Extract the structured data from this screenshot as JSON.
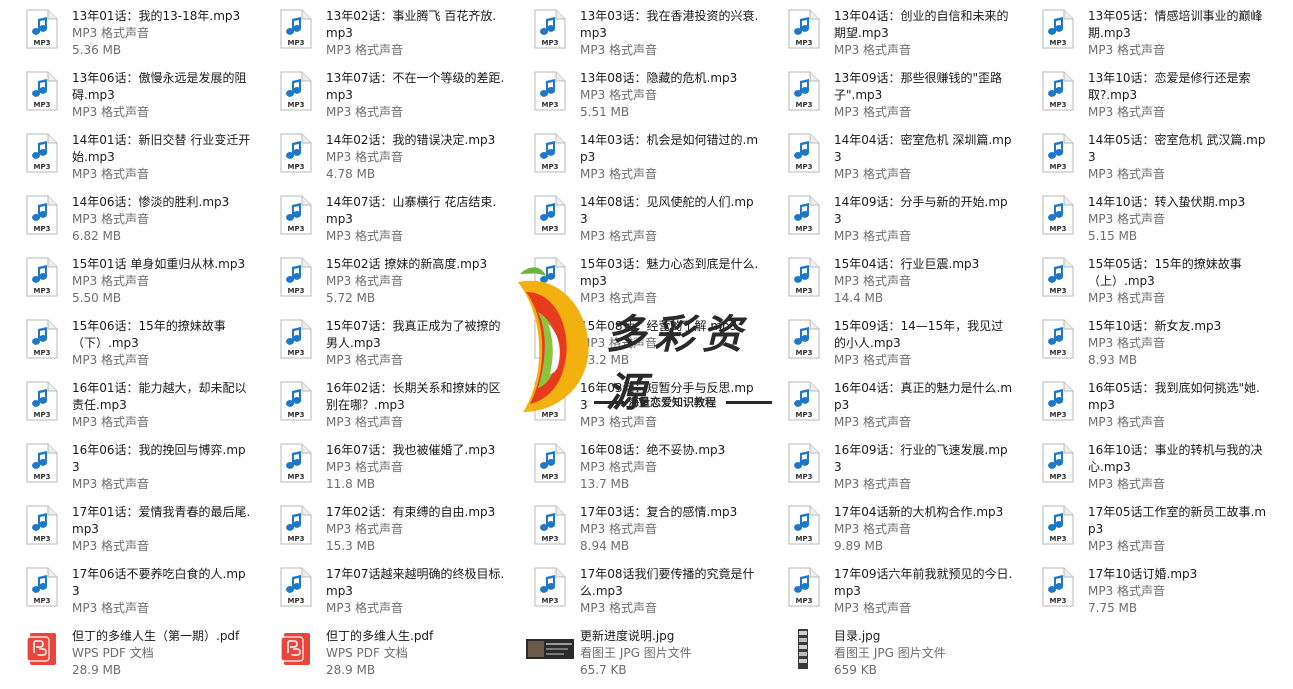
{
  "files": [
    {
      "name": "13年01话：我的13-18年.mp3",
      "type": "MP3 格式声音",
      "size": "5.36 MB",
      "icon": "mp3-file-icon"
    },
    {
      "name": "13年02话：事业腾飞 百花齐放.mp3",
      "type": "MP3 格式声音",
      "size": "",
      "icon": "mp3-file-icon"
    },
    {
      "name": "13年03话：我在香港投资的兴衰.mp3",
      "type": "MP3 格式声音",
      "size": "",
      "icon": "mp3-file-icon"
    },
    {
      "name": "13年04话：创业的自信和未来的期望.mp3",
      "type": "MP3 格式声音",
      "size": "",
      "icon": "mp3-file-icon"
    },
    {
      "name": "13年05话：情感培训事业的巅峰期.mp3",
      "type": "MP3 格式声音",
      "size": "",
      "icon": "mp3-file-icon"
    },
    {
      "name": "13年06话：傲慢永远是发展的阻碍.mp3",
      "type": "MP3 格式声音",
      "size": "",
      "icon": "mp3-file-icon"
    },
    {
      "name": "13年07话：不在一个等级的差距.mp3",
      "type": "MP3 格式声音",
      "size": "",
      "icon": "mp3-file-icon"
    },
    {
      "name": "13年08话：隐藏的危机.mp3",
      "type": "MP3 格式声音",
      "size": "5.51 MB",
      "icon": "mp3-file-icon"
    },
    {
      "name": "13年09话：那些很赚钱的\"歪路子\".mp3",
      "type": "MP3 格式声音",
      "size": "",
      "icon": "mp3-file-icon"
    },
    {
      "name": "13年10话：恋爱是修行还是索取?.mp3",
      "type": "MP3 格式声音",
      "size": "",
      "icon": "mp3-file-icon"
    },
    {
      "name": "14年01话：新旧交替 行业变迁开始.mp3",
      "type": "MP3 格式声音",
      "size": "",
      "icon": "mp3-file-icon"
    },
    {
      "name": "14年02话：我的错误决定.mp3",
      "type": "MP3 格式声音",
      "size": "4.78 MB",
      "icon": "mp3-file-icon"
    },
    {
      "name": "14年03话：机会是如何错过的.mp3",
      "type": "MP3 格式声音",
      "size": "",
      "icon": "mp3-file-icon"
    },
    {
      "name": "14年04话：密室危机 深圳篇.mp3",
      "type": "MP3 格式声音",
      "size": "8.16 MB",
      "icon": "mp3-file-icon"
    },
    {
      "name": "14年05话：密室危机 武汉篇.mp3",
      "type": "MP3 格式声音",
      "size": "4.85 MB",
      "icon": "mp3-file-icon"
    },
    {
      "name": "14年06话：惨淡的胜利.mp3",
      "type": "MP3 格式声音",
      "size": "6.82 MB",
      "icon": "mp3-file-icon"
    },
    {
      "name": "14年07话：山寨横行 花店结束.mp3",
      "type": "MP3 格式声音",
      "size": "",
      "icon": "mp3-file-icon"
    },
    {
      "name": "14年08话：见风使舵的人们.mp3",
      "type": "MP3 格式声音",
      "size": "5.29 MB",
      "icon": "mp3-file-icon"
    },
    {
      "name": "14年09话：分手与新的开始.mp3",
      "type": "MP3 格式声音",
      "size": "4.84 MB",
      "icon": "mp3-file-icon"
    },
    {
      "name": "14年10话：转入蛰伏期.mp3",
      "type": "MP3 格式声音",
      "size": "5.15 MB",
      "icon": "mp3-file-icon"
    },
    {
      "name": "15年01话 单身如重归从林.mp3",
      "type": "MP3 格式声音",
      "size": "5.50 MB",
      "icon": "mp3-file-icon"
    },
    {
      "name": "15年02话 撩妹的新高度.mp3",
      "type": "MP3 格式声音",
      "size": "5.72 MB",
      "icon": "mp3-file-icon"
    },
    {
      "name": "15年03话：魅力心态到底是什么.mp3",
      "type": "MP3 格式声音",
      "size": "",
      "icon": "mp3-file-icon"
    },
    {
      "name": "15年04话：行业巨震.mp3",
      "type": "MP3 格式声音",
      "size": "14.4 MB",
      "icon": "mp3-file-icon"
    },
    {
      "name": "15年05话：15年的撩妹故事（上）.mp3",
      "type": "MP3 格式声音",
      "size": "",
      "icon": "mp3-file-icon"
    },
    {
      "name": "15年06话：15年的撩妹故事（下）.mp3",
      "type": "MP3 格式声音",
      "size": "",
      "icon": "mp3-file-icon"
    },
    {
      "name": "15年07话：我真正成为了被撩的男人.mp3",
      "type": "MP3 格式声音",
      "size": "",
      "icon": "mp3-file-icon"
    },
    {
      "name": "15年08话：经营的了解.mp3",
      "type": "MP3 格式声音",
      "size": "13.2 MB",
      "icon": "mp3-file-icon"
    },
    {
      "name": "15年09话：14—15年，我见过的小人.mp3",
      "type": "MP3 格式声音",
      "size": "",
      "icon": "mp3-file-icon"
    },
    {
      "name": "15年10话：新女友.mp3",
      "type": "MP3 格式声音",
      "size": "8.93 MB",
      "icon": "mp3-file-icon"
    },
    {
      "name": "16年01话：能力越大，却未配以责任.mp3",
      "type": "MP3 格式声音",
      "size": "",
      "icon": "mp3-file-icon"
    },
    {
      "name": "16年02话：长期关系和撩妹的区别在哪？.mp3",
      "type": "MP3 格式声音",
      "size": "",
      "icon": "mp3-file-icon"
    },
    {
      "name": "16年03话：短暂分手与反思.mp3",
      "type": "MP3 格式声音",
      "size": "10.0 MB",
      "icon": "mp3-file-icon"
    },
    {
      "name": "16年04话：真正的魅力是什么.mp3",
      "type": "MP3 格式声音",
      "size": "",
      "icon": "mp3-file-icon"
    },
    {
      "name": "16年05话：我到底如何挑选\"她.mp3",
      "type": "MP3 格式声音",
      "size": "",
      "icon": "mp3-file-icon"
    },
    {
      "name": "16年06话：我的挽回与博弈.mp3",
      "type": "MP3 格式声音",
      "size": "17.6 MB",
      "icon": "mp3-file-icon"
    },
    {
      "name": "16年07话：我也被催婚了.mp3",
      "type": "MP3 格式声音",
      "size": "11.8 MB",
      "icon": "mp3-file-icon"
    },
    {
      "name": "16年08话：绝不妥协.mp3",
      "type": "MP3 格式声音",
      "size": "13.7 MB",
      "icon": "mp3-file-icon"
    },
    {
      "name": "16年09话：行业的飞速发展.mp3",
      "type": "MP3 格式声音",
      "size": "14.3 MB",
      "icon": "mp3-file-icon"
    },
    {
      "name": "16年10话：事业的转机与我的决心.mp3",
      "type": "MP3 格式声音",
      "size": "",
      "icon": "mp3-file-icon"
    },
    {
      "name": "17年01话：爱情我青春的最后尾.mp3",
      "type": "MP3 格式声音",
      "size": "",
      "icon": "mp3-file-icon"
    },
    {
      "name": "17年02话：有束缚的自由.mp3",
      "type": "MP3 格式声音",
      "size": "15.3 MB",
      "icon": "mp3-file-icon"
    },
    {
      "name": "17年03话：复合的感情.mp3",
      "type": "MP3 格式声音",
      "size": "8.94 MB",
      "icon": "mp3-file-icon"
    },
    {
      "name": "17年04话新的大机构合作.mp3",
      "type": "MP3 格式声音",
      "size": "9.89 MB",
      "icon": "mp3-file-icon"
    },
    {
      "name": "17年05话工作室的新员工故事.mp3",
      "type": "MP3 格式声音",
      "size": "",
      "icon": "mp3-file-icon"
    },
    {
      "name": "17年06话不要养吃白食的人.mp3",
      "type": "MP3 格式声音",
      "size": "11.8 MB",
      "icon": "mp3-file-icon"
    },
    {
      "name": "17年07话越来越明确的终极目标.mp3",
      "type": "MP3 格式声音",
      "size": "",
      "icon": "mp3-file-icon"
    },
    {
      "name": "17年08话我们要传播的究竟是什么.mp3",
      "type": "MP3 格式声音",
      "size": "",
      "icon": "mp3-file-icon"
    },
    {
      "name": "17年09话六年前我就预见的今日.mp3",
      "type": "MP3 格式声音",
      "size": "",
      "icon": "mp3-file-icon"
    },
    {
      "name": "17年10话订婚.mp3",
      "type": "MP3 格式声音",
      "size": "7.75 MB",
      "icon": "mp3-file-icon"
    },
    {
      "name": "但丁的多维人生（第一期）.pdf",
      "type": "WPS PDF 文档",
      "size": "28.9 MB",
      "icon": "pdf-file-icon"
    },
    {
      "name": "但丁的多维人生.pdf",
      "type": "WPS PDF 文档",
      "size": "28.9 MB",
      "icon": "pdf-file-icon"
    },
    {
      "name": "更新进度说明.jpg",
      "type": "看图王 JPG 图片文件",
      "size": "65.7 KB",
      "icon": "jpg-thumbnail-icon"
    },
    {
      "name": "目录.jpg",
      "type": "看图王 JPG 图片文件",
      "size": "659 KB",
      "icon": "jpg-film-thumbnail-icon"
    }
  ],
  "watermark": {
    "title": "多彩资源",
    "subtitle": "海量恋爱知识教程",
    "logo_icon": "colorful-d-logo-icon"
  },
  "colors": {
    "text": "#1a1a1a",
    "muted": "#6d6d6d",
    "mp3_note": "#1e78c8",
    "pdf_red": "#e8453c"
  }
}
